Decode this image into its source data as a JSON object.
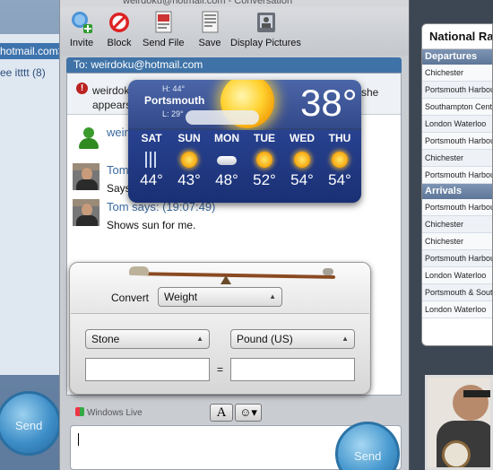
{
  "left_window": {
    "email": "hotmail.com>",
    "contact_item": "ee itttt (8)",
    "send_label": "Send"
  },
  "conversation": {
    "title": "weirdoku@hotmail.com - Conversation",
    "toolbar": {
      "invite": "Invite",
      "block": "Block",
      "send_file": "Send File",
      "save": "Save",
      "display_pictures": "Display Pictures"
    },
    "to_line": "To: weirdoku@hotmail.com",
    "notice": {
      "line1": "weirdok",
      "line2": "appears to b",
      "line3": "she"
    },
    "messages": [
      {
        "sender": "weird"
      },
      {
        "sender": "Tom",
        "text": "Says"
      },
      {
        "sender": "Tom says: (19:07:49)",
        "text": "Shows sun for me."
      }
    ],
    "footer": {
      "brand": "Windows Live",
      "font_button": "A",
      "emoticon_button": "☺▾",
      "send_label": "Send"
    }
  },
  "rail": {
    "title": "National Rail",
    "departures_label": "Departures",
    "departures": [
      "Chichester",
      "Portsmouth Harbour",
      "Southampton Central",
      "London Waterloo",
      "Portsmouth Harbour",
      "Chichester",
      "Portsmouth Harbour"
    ],
    "arrivals_label": "Arrivals",
    "arrivals": [
      "Portsmouth Harbour",
      "Chichester",
      "Chichester",
      "Portsmouth Harbour",
      "London Waterloo",
      "Portsmouth & Southsea",
      "London Waterloo"
    ]
  },
  "weather": {
    "city": "Portsmouth",
    "high": "H: 44°",
    "low": "L: 29°",
    "current_temp": "38°",
    "forecast": [
      {
        "day": "SAT",
        "temp": "44°",
        "icon": "rain-icon"
      },
      {
        "day": "SUN",
        "temp": "43°",
        "icon": "sun-icon"
      },
      {
        "day": "MON",
        "temp": "48°",
        "icon": "cloud-icon"
      },
      {
        "day": "TUE",
        "temp": "52°",
        "icon": "partly-sunny-icon"
      },
      {
        "day": "WED",
        "temp": "54°",
        "icon": "partly-sunny-icon"
      },
      {
        "day": "THU",
        "temp": "54°",
        "icon": "sun-icon"
      }
    ]
  },
  "converter": {
    "convert_label": "Convert",
    "category": "Weight",
    "from_unit": "Stone",
    "to_unit": "Pound (US)",
    "equals": "=",
    "from_value": "",
    "to_value": ""
  }
}
